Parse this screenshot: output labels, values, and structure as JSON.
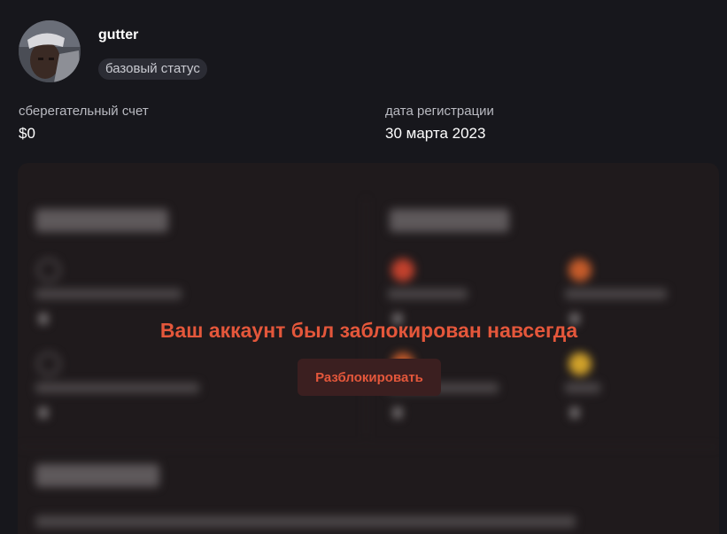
{
  "profile": {
    "username": "gutter",
    "status": "базовый статус"
  },
  "stats": {
    "savings_label": "сберегательный счет",
    "savings_value": "$0",
    "registration_label": "дата регистрации",
    "registration_value": "30 марта 2023"
  },
  "overlay": {
    "ban_message": "Ваш аккаунт был заблокирован навсегда",
    "unblock_label": "Разблокировать"
  },
  "colors": {
    "background": "#17171c",
    "accent_red": "#e4573b",
    "button_bg": "#3b1f20",
    "badge_bg": "#2b2c34"
  }
}
